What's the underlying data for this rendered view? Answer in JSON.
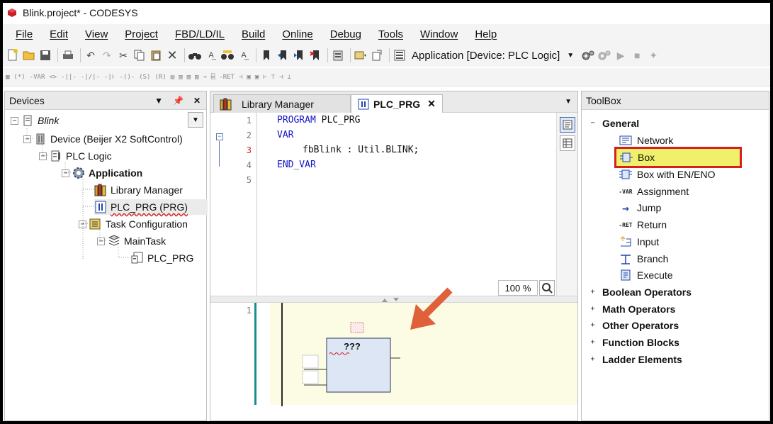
{
  "window": {
    "title": "Blink.project* - CODESYS"
  },
  "menu": [
    "File",
    "Edit",
    "View",
    "Project",
    "FBD/LD/IL",
    "Build",
    "Online",
    "Debug",
    "Tools",
    "Window",
    "Help"
  ],
  "toolbar": {
    "active_application": "Application [Device: PLC Logic]"
  },
  "toolbar2_labels": {
    "var": "-VAR",
    "ret": "-RET",
    "cont": "(*)"
  },
  "devices": {
    "title": "Devices",
    "root": "Blink",
    "tree": [
      {
        "label": "Device (Beijer X2 SoftControl)",
        "icon": "device-icon"
      },
      {
        "label": "PLC Logic",
        "icon": "plc-logic-icon"
      },
      {
        "label": "Application",
        "icon": "application-gear-icon"
      },
      {
        "label": "Library Manager",
        "icon": "library-books-icon"
      },
      {
        "label": "PLC_PRG (PRG)",
        "icon": "program-icon"
      },
      {
        "label": "Task Configuration",
        "icon": "task-configuration-icon"
      },
      {
        "label": "MainTask",
        "icon": "task-icon"
      },
      {
        "label": "PLC_PRG",
        "icon": "program-call-icon"
      }
    ]
  },
  "editor": {
    "tabs": [
      {
        "label": "Library Manager",
        "active": false
      },
      {
        "label": "PLC_PRG",
        "active": true
      }
    ],
    "declaration": {
      "line_numbers": [
        "1",
        "2",
        "3",
        "4",
        "5"
      ],
      "line1_kw": "PROGRAM",
      "line1_rest": " PLC_PRG",
      "line2": "VAR",
      "line3": "fbBlink : Util.BLINK;",
      "line4": "END_VAR",
      "zoom": "100 %"
    },
    "implementation": {
      "network_number": "1",
      "box_placeholder": "???"
    }
  },
  "toolbox": {
    "title": "ToolBox",
    "general_category": "General",
    "general_items": [
      {
        "label": "Network",
        "icon": "network-icon"
      },
      {
        "label": "Box",
        "icon": "box-icon",
        "highlighted": true
      },
      {
        "label": "Box with EN/ENO",
        "icon": "box-en-eno-icon"
      },
      {
        "label": "Assignment",
        "icon": "assignment-icon",
        "glyph": "-VAR"
      },
      {
        "label": "Jump",
        "icon": "jump-arrow-icon"
      },
      {
        "label": "Return",
        "icon": "return-icon",
        "glyph": "-RET"
      },
      {
        "label": "Input",
        "icon": "input-icon"
      },
      {
        "label": "Branch",
        "icon": "branch-icon"
      },
      {
        "label": "Execute",
        "icon": "execute-icon"
      }
    ],
    "categories": [
      "Boolean Operators",
      "Math Operators",
      "Other Operators",
      "Function Blocks",
      "Ladder Elements"
    ]
  },
  "colors": {
    "keyword": "#1414c8",
    "highlight_fill": "#f0f06a",
    "highlight_border": "#d42020",
    "annotation_arrow": "#e0603a",
    "network_bg": "#fcfbe3",
    "fbd_box_fill": "#dde6f4"
  }
}
